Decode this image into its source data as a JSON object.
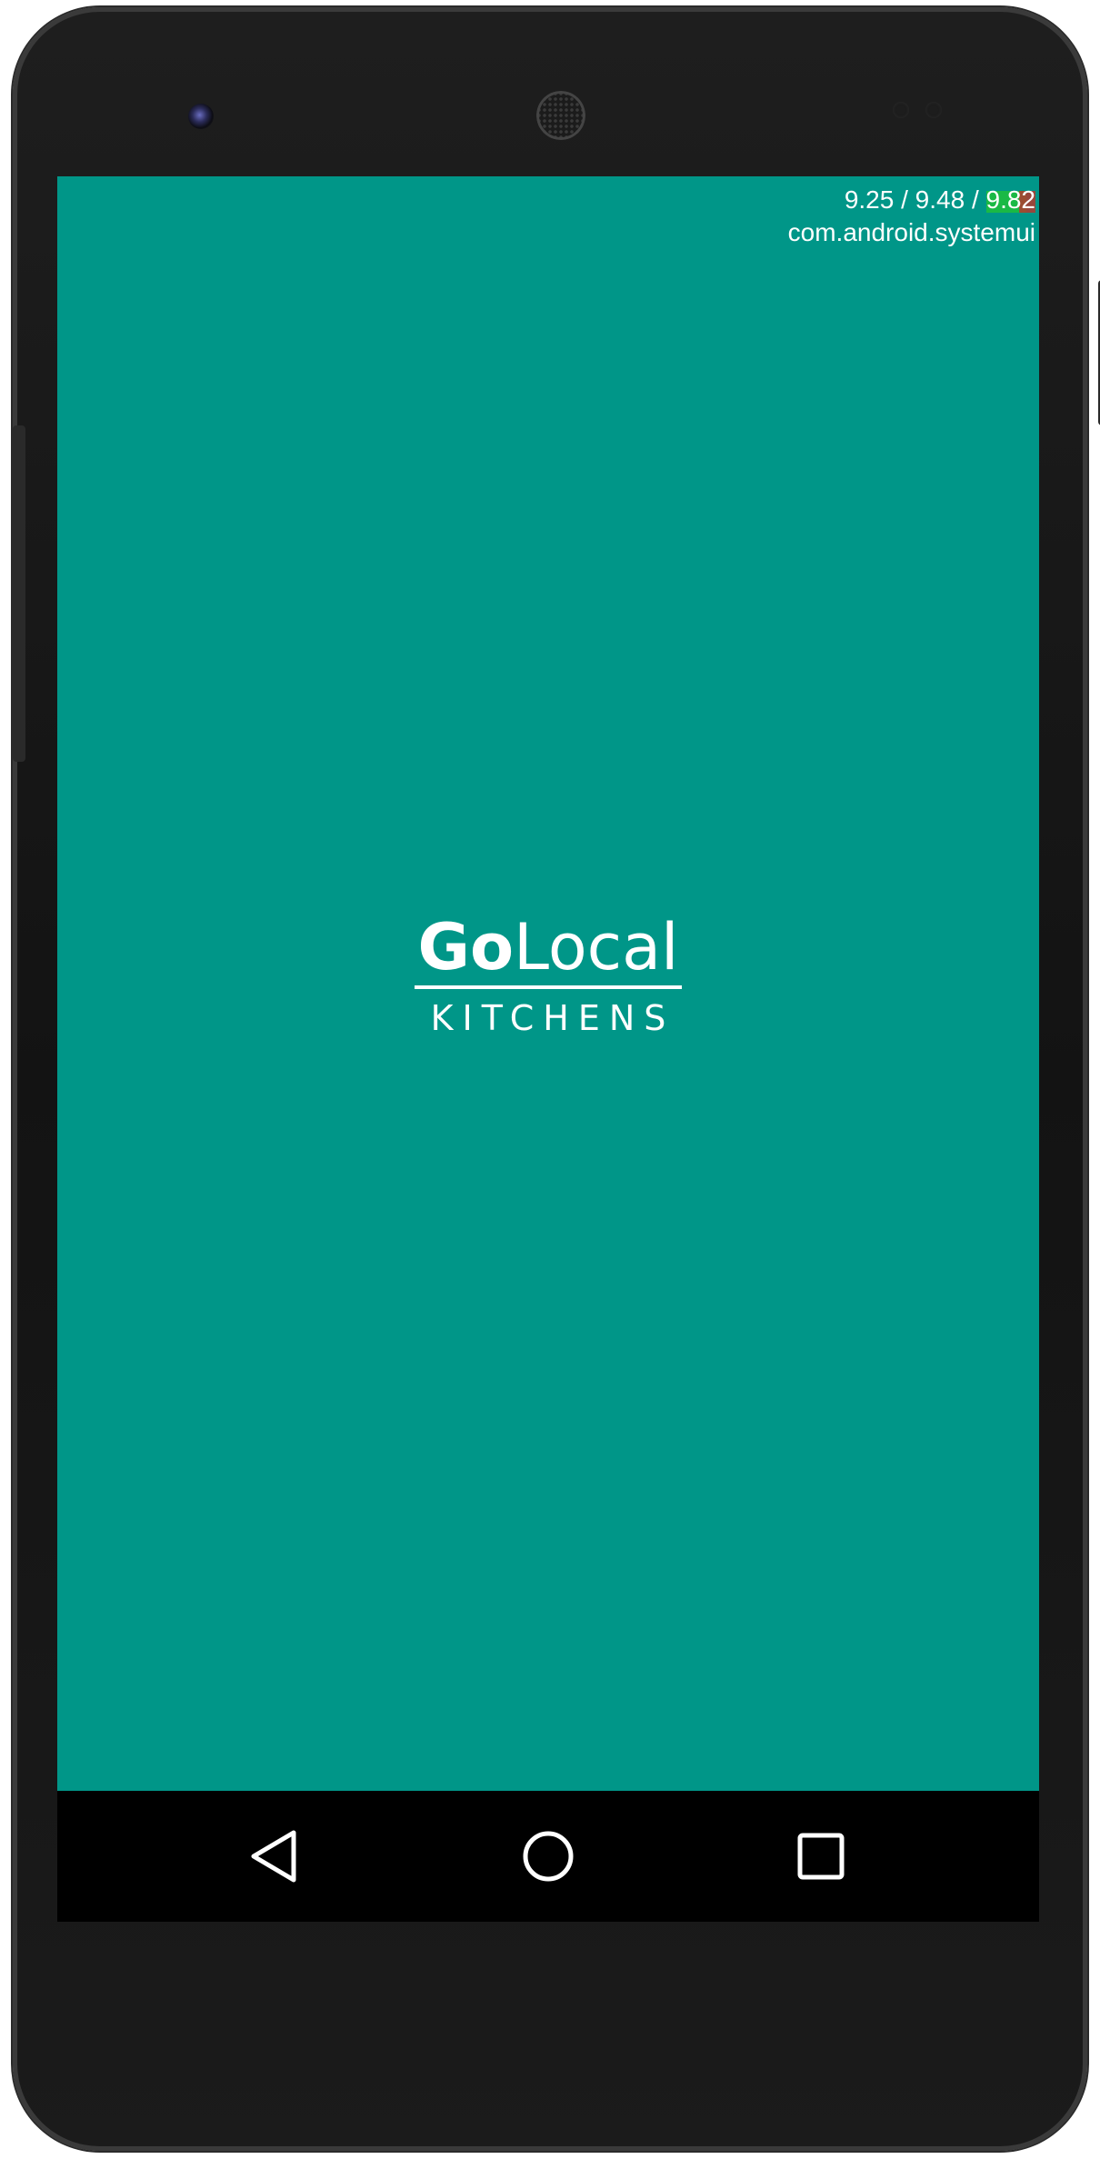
{
  "app": {
    "name_bold": "Go",
    "name_regular": "Local",
    "subtitle": "KITCHENS"
  },
  "debug_overlay": {
    "load_average": "9.25 / 9.48 / 9.82",
    "process": "com.android.systemui"
  },
  "colors": {
    "screen_background": "#009688",
    "nav_bar": "#000000",
    "text": "#ffffff"
  },
  "nav_bar": {
    "buttons": [
      "back-icon",
      "home-icon",
      "recents-icon"
    ]
  }
}
